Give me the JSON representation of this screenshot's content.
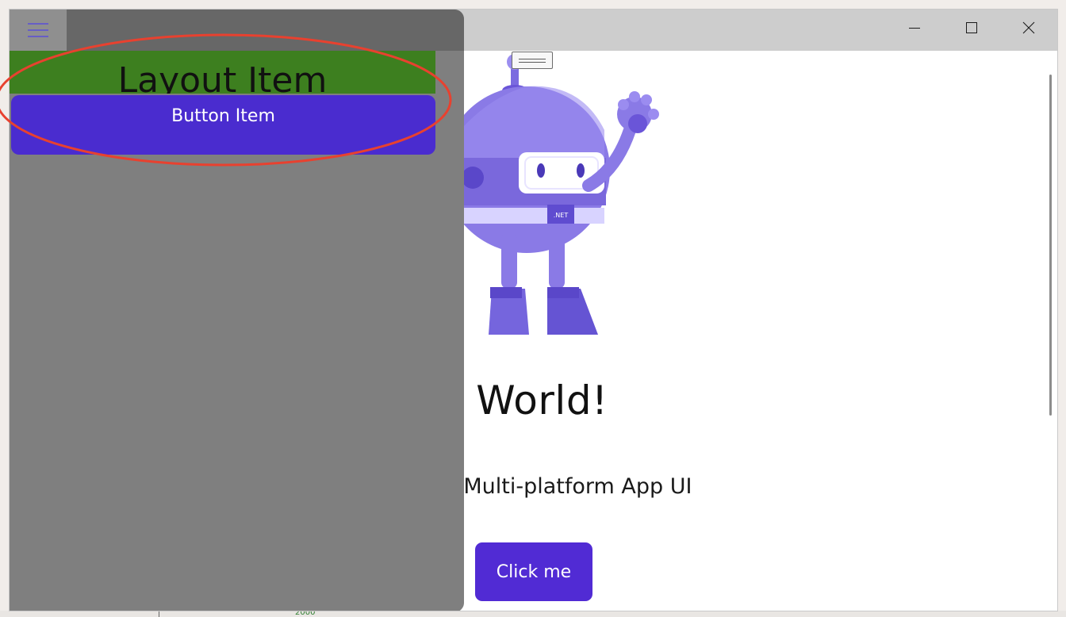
{
  "flyout": {
    "layout_item_label": "Layout Item",
    "button_item_label": "Button Item"
  },
  "main": {
    "heading": "Hello, World!",
    "heading_visible": "lo, World!",
    "subtitle": "Welcome to .NET Multi-platform App UI",
    "subtitle_visible": "NET Multi-platform App UI",
    "click_button_label": "Click me"
  },
  "window_controls": {
    "minimize_icon": "minimize-icon",
    "maximize_icon": "maximize-icon",
    "close_icon": "close-icon"
  },
  "background": {
    "glyph_1": "",
    "glyph_2": "",
    "glyph_3": "2000"
  },
  "colors": {
    "accent": "#512bd4",
    "layout_item_bg": "#3d7f1f",
    "button_item_bg": "#4a2ccf",
    "flyout_bg": "#7f7f7f",
    "annotation": "#e8412f"
  }
}
